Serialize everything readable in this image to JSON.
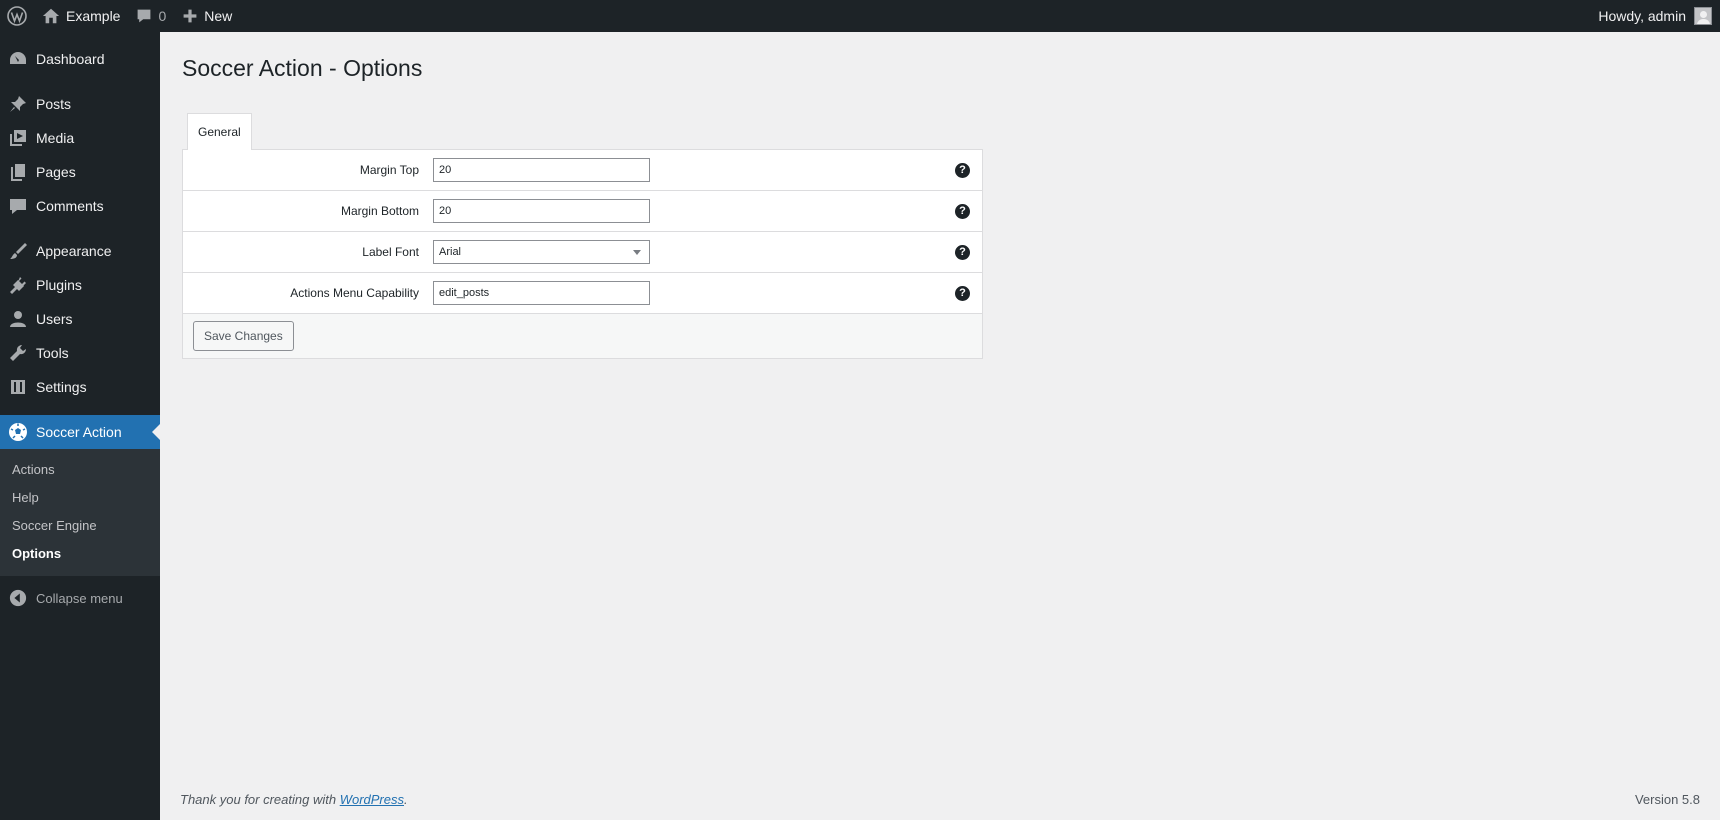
{
  "adminbar": {
    "site_name": "Example",
    "comments_count": "0",
    "new_label": "New",
    "greeting": "Howdy, admin"
  },
  "sidebar": {
    "items": [
      {
        "label": "Dashboard",
        "icon": "dashboard-icon"
      },
      {
        "label": "Posts",
        "icon": "pin-icon"
      },
      {
        "label": "Media",
        "icon": "media-icon"
      },
      {
        "label": "Pages",
        "icon": "pages-icon"
      },
      {
        "label": "Comments",
        "icon": "comment-icon"
      },
      {
        "label": "Appearance",
        "icon": "brush-icon"
      },
      {
        "label": "Plugins",
        "icon": "plug-icon"
      },
      {
        "label": "Users",
        "icon": "user-icon"
      },
      {
        "label": "Tools",
        "icon": "wrench-icon"
      },
      {
        "label": "Settings",
        "icon": "settings-icon"
      },
      {
        "label": "Soccer Action",
        "icon": "soccer-ball-icon"
      }
    ],
    "submenu": [
      "Actions",
      "Help",
      "Soccer Engine",
      "Options"
    ],
    "collapse_label": "Collapse menu"
  },
  "main": {
    "title": "Soccer Action - Options",
    "tab_label": "General",
    "fields": [
      {
        "label": "Margin Top",
        "value": "20"
      },
      {
        "label": "Margin Bottom",
        "value": "20"
      },
      {
        "label": "Label Font",
        "value": "Arial"
      },
      {
        "label": "Actions Menu Capability",
        "value": "edit_posts"
      }
    ],
    "help_glyph": "?",
    "save_label": "Save Changes"
  },
  "footer": {
    "thanks_prefix": "Thank you for creating with ",
    "thanks_link": "WordPress",
    "thanks_suffix": ".",
    "version": "Version 5.8"
  },
  "colors": {
    "admin_bg": "#1d2327",
    "accent": "#2271b1",
    "page_bg": "#f0f0f1"
  }
}
